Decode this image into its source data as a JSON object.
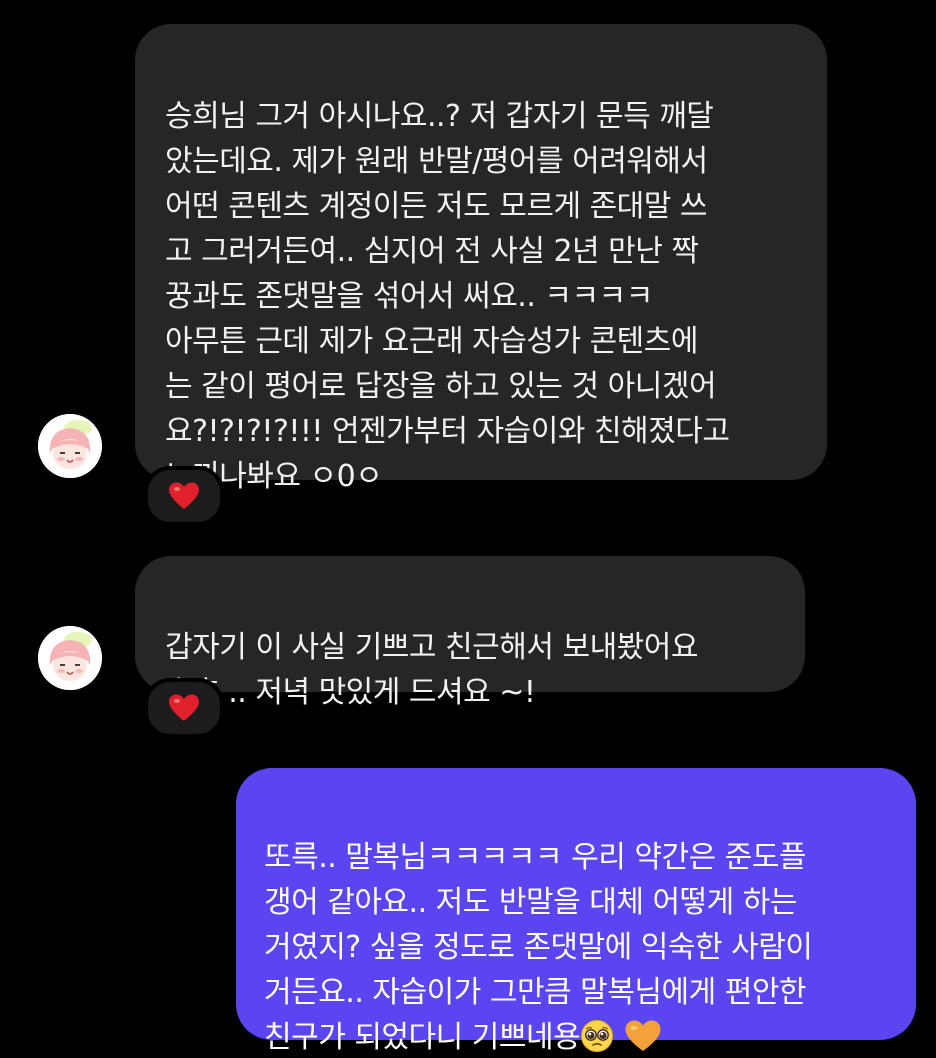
{
  "messages": [
    {
      "direction": "incoming",
      "text": "승희님 그거 아시나요..? 저 갑자기 문득 깨달\n았는데요. 제가 원래 반말/평어를 어려워해서\n어떤 콘텐츠 계정이든 저도 모르게 존대말 쓰\n고 그러거든여.. 심지어 전 사실 2년 만난 짝\n꿍과도 존댓말을 섞어서 써요.. ㅋㅋㅋㅋ\n아무튼 근데 제가 요근래 자습성가 콘텐츠에\n는 같이 평어로 답장을 하고 있는 것 아니겠어\n요?!?!?!?!!! 언젠가부터 자습이와 친해졌다고\n느끼나봐요 ㅇ0ㅇ",
      "reaction": "heart-reaction"
    },
    {
      "direction": "incoming",
      "text": "갑자기 이 사실 기쁘고 친근해서 보내봤어요\n호호 .. 저녁 맛있게 드셔요 ~!",
      "reaction": "heart-reaction"
    },
    {
      "direction": "outgoing",
      "text": "또륵.. 말복님ㅋㅋㅋㅋㅋ 우리 약간은 준도플\n갱어 같아요.. 저도 반말을 대체 어떻게 하는\n거였지? 싶을 정도로 존댓말에 익숙한 사람이\n거든요.. 자습이가 그만큼 말복님에게 편안한\n친구가 되었다니 기쁘네용",
      "trailing_emojis": [
        "pleading-face-icon",
        "orange-heart-icon"
      ]
    }
  ],
  "colors": {
    "background": "#000000",
    "incoming_bubble": "#262629",
    "outgoing_bubble": "#5a45f0",
    "heart": "#e0202a",
    "orange_heart": "#f5a13a"
  }
}
